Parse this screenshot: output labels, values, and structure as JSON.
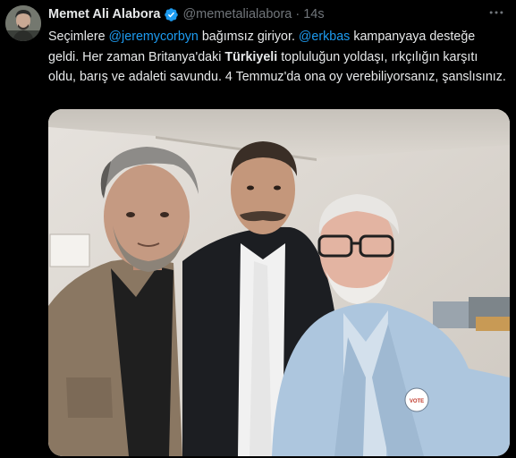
{
  "tweet": {
    "author_name": "Memet Ali Alabora",
    "author_handle": "@memetalialabora",
    "separator": "·",
    "timestamp": "14s",
    "verified_icon": "verified-badge-icon",
    "more_icon": "more-options-icon",
    "text": {
      "p1": "Seçimlere ",
      "mention1": "@jeremycorbyn",
      "p2": " bağımsız giriyor. ",
      "mention2": "@erkbas",
      "p3": " kampanyaya desteğe geldi. Her zaman Britanya'daki ",
      "bold1": "Türkiyeli",
      "p4": " topluluğun yoldaşı, ırkçılığın karşıtı oldu, barış ve adaleti savundu. 4 Temmuz'da ona oy verebiliyorsanız, şanslısınız."
    },
    "badge_text": "VOTE"
  },
  "colors": {
    "background": "#000000",
    "text": "#e7e9ea",
    "secondary": "#71767b",
    "link": "#1d9bf0"
  }
}
